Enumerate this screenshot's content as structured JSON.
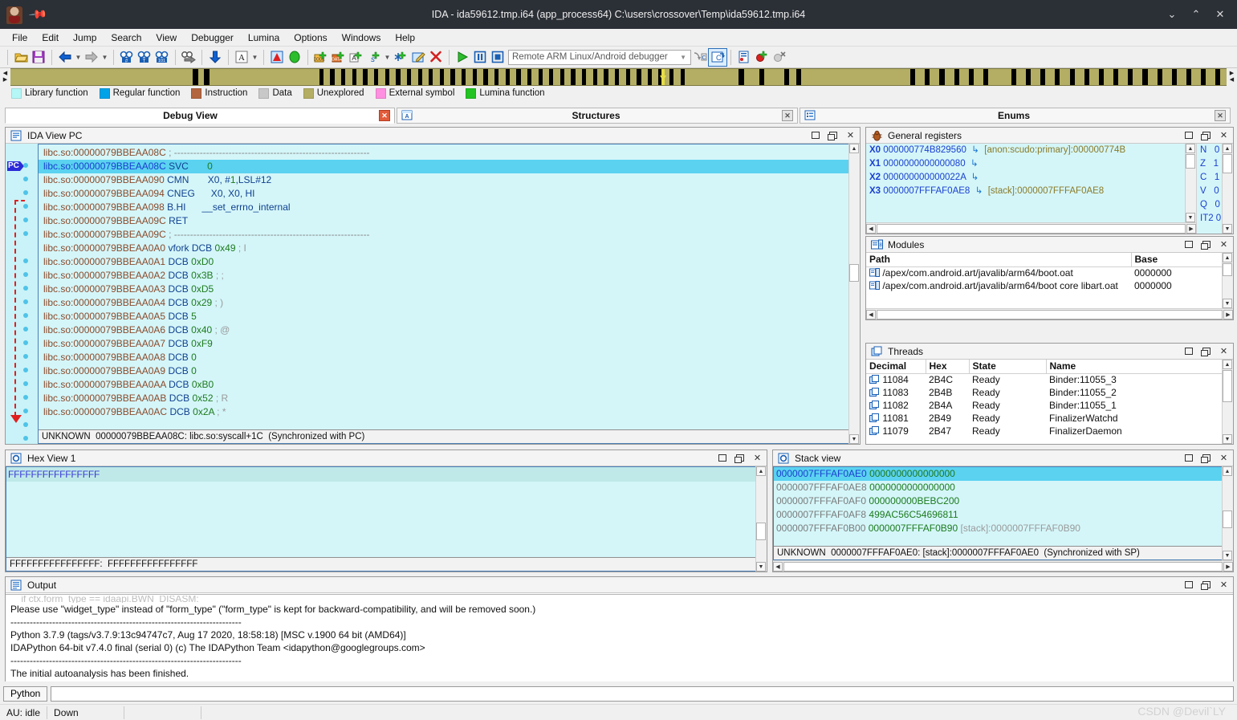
{
  "window": {
    "title": "IDA - ida59612.tmp.i64 (app_process64) C:\\users\\crossover\\Temp\\ida59612.tmp.i64",
    "minimize": "⌄",
    "maximize": "⌃",
    "close": "✕",
    "pin_icon": "pin-icon"
  },
  "menu": [
    {
      "label": "File"
    },
    {
      "label": "Edit"
    },
    {
      "label": "Jump"
    },
    {
      "label": "Search"
    },
    {
      "label": "View"
    },
    {
      "label": "Debugger"
    },
    {
      "label": "Lumina"
    },
    {
      "label": "Options"
    },
    {
      "label": "Windows"
    },
    {
      "label": "Help"
    }
  ],
  "toolbar": {
    "debugger_select": "Remote ARM Linux/Android debugger",
    "icons": [
      "open-file-icon",
      "save-icon",
      "back-icon",
      "forward-icon",
      "search-hash-icon",
      "search-text-icon",
      "search-binary-icon",
      "jump-xref-icon",
      "jump-down-icon",
      "ascii-icon",
      "alert-icon",
      "green-circle-icon",
      "make-code-icon",
      "make-data-icon",
      "make-ascii-icon",
      "make-struct-icon",
      "make-array-icon",
      "edit-func-icon",
      "delete-icon",
      "run-icon",
      "pause-icon",
      "stop-icon",
      "step-into-icon",
      "step-over-icon",
      "breakpoints-icon",
      "add-breakpoint-icon",
      "delete-breakpoint-icon"
    ]
  },
  "navband": {
    "legend": [
      {
        "label": "Library function",
        "color": "#b5f7f7"
      },
      {
        "label": "Regular function",
        "color": "#00a2e8"
      },
      {
        "label": "Instruction",
        "color": "#b3653f"
      },
      {
        "label": "Data",
        "color": "#c8c8c8"
      },
      {
        "label": "Unexplored",
        "color": "#b3ae64"
      },
      {
        "label": "External symbol",
        "color": "#ff8fe0"
      },
      {
        "label": "Lumina function",
        "color": "#22c322"
      }
    ],
    "cursor_position_pct": 53.5,
    "segments_pct": [
      [
        15.0,
        0.45
      ],
      [
        15.9,
        0.45
      ],
      [
        25.4,
        0.35
      ],
      [
        26.3,
        0.35
      ],
      [
        27.2,
        0.35
      ],
      [
        28.1,
        0.35
      ],
      [
        29.0,
        0.35
      ],
      [
        29.9,
        0.35
      ],
      [
        30.8,
        0.35
      ],
      [
        31.7,
        0.35
      ],
      [
        32.6,
        0.35
      ],
      [
        33.5,
        0.35
      ],
      [
        34.4,
        0.35
      ],
      [
        35.3,
        0.35
      ],
      [
        36.2,
        0.35
      ],
      [
        37.1,
        0.35
      ],
      [
        38.0,
        0.35
      ],
      [
        38.9,
        0.35
      ],
      [
        39.8,
        0.35
      ],
      [
        40.7,
        0.35
      ],
      [
        41.6,
        0.35
      ],
      [
        42.5,
        0.35
      ],
      [
        43.4,
        0.35
      ],
      [
        44.3,
        0.35
      ],
      [
        45.2,
        0.35
      ],
      [
        46.1,
        0.35
      ],
      [
        47.0,
        0.35
      ],
      [
        47.9,
        0.35
      ],
      [
        48.8,
        0.35
      ],
      [
        49.7,
        0.35
      ],
      [
        50.6,
        0.35
      ],
      [
        51.5,
        0.35
      ],
      [
        52.4,
        0.35
      ],
      [
        53.3,
        0.35
      ],
      [
        54.2,
        0.35
      ],
      [
        55.1,
        0.35
      ],
      [
        59.9,
        0.4
      ],
      [
        61.6,
        0.4
      ],
      [
        63.6,
        0.4
      ],
      [
        64.6,
        0.4
      ],
      [
        74.0,
        0.4
      ],
      [
        75.2,
        0.4
      ],
      [
        76.4,
        0.4
      ],
      [
        77.6,
        0.4
      ],
      [
        78.8,
        0.4
      ],
      [
        80.0,
        0.4
      ],
      [
        82.3,
        0.4
      ],
      [
        83.5,
        0.4
      ],
      [
        84.7,
        0.4
      ],
      [
        85.9,
        0.4
      ],
      [
        87.1,
        0.4
      ],
      [
        88.3,
        0.4
      ],
      [
        89.5,
        0.4
      ],
      [
        90.7,
        0.4
      ],
      [
        91.9,
        0.4
      ],
      [
        93.1,
        0.4
      ],
      [
        94.3,
        0.4
      ],
      [
        95.5,
        0.4
      ],
      [
        96.7,
        0.4
      ],
      [
        97.9,
        0.4
      ],
      [
        99.1,
        0.4
      ]
    ]
  },
  "window_tabs": [
    {
      "label": "Debug View",
      "active": true,
      "icon": "debug-view-icon",
      "close": "✕"
    },
    {
      "label": "Structures",
      "active": false,
      "icon": "structures-icon",
      "close": "✕"
    },
    {
      "label": "Enums",
      "active": false,
      "icon": "enums-icon",
      "close": "✕"
    }
  ],
  "ida_view": {
    "title": "IDA View PC",
    "icon": "ida-view-icon",
    "buttons": {
      "restore": "restore-icon",
      "tile": "tile-icon",
      "close": "✕"
    },
    "status": "UNKNOWN  00000079BBEAA08C: libc.so:syscall+1C  (Synchronized with PC)",
    "lines": [
      {
        "seg": "libc.so:00000079BBEAA08C",
        "mnem": "",
        "ops": "",
        "comment": "; -------------------------------------------------------------",
        "sel": false,
        "type": "sep"
      },
      {
        "seg": "libc.so:00000079BBEAA08C",
        "mnem": "SVC",
        "ops": "0",
        "comment": "",
        "sel": true,
        "type": "ins"
      },
      {
        "seg": "libc.so:00000079BBEAA090",
        "mnem": "CMN",
        "ops": "X0, #1,LSL#12",
        "comment": "",
        "sel": false,
        "type": "ins"
      },
      {
        "seg": "libc.so:00000079BBEAA094",
        "mnem": "CNEG",
        "ops": "X0, X0, HI",
        "comment": "",
        "sel": false,
        "type": "ins"
      },
      {
        "seg": "libc.so:00000079BBEAA098",
        "mnem": "B.HI",
        "ops": "__set_errno_internal",
        "comment": "",
        "sel": false,
        "type": "ins"
      },
      {
        "seg": "libc.so:00000079BBEAA09C",
        "mnem": "RET",
        "ops": "",
        "comment": "",
        "sel": false,
        "type": "ins"
      },
      {
        "seg": "libc.so:00000079BBEAA09C",
        "mnem": "",
        "ops": "",
        "comment": "; -------------------------------------------------------------",
        "sel": false,
        "type": "sep"
      },
      {
        "seg": "libc.so:00000079BBEAA0A0",
        "label": "vfork",
        "mnem": "DCB",
        "ops": "0x49",
        "comment": "; I",
        "sel": false,
        "type": "dcb"
      },
      {
        "seg": "libc.so:00000079BBEAA0A1",
        "mnem": "DCB",
        "ops": "0xD0",
        "comment": "",
        "sel": false,
        "type": "dcb"
      },
      {
        "seg": "libc.so:00000079BBEAA0A2",
        "mnem": "DCB",
        "ops": "0x3B",
        "comment": "; ;",
        "sel": false,
        "type": "dcb"
      },
      {
        "seg": "libc.so:00000079BBEAA0A3",
        "mnem": "DCB",
        "ops": "0xD5",
        "comment": "",
        "sel": false,
        "type": "dcb"
      },
      {
        "seg": "libc.so:00000079BBEAA0A4",
        "mnem": "DCB",
        "ops": "0x29",
        "comment": "; )",
        "sel": false,
        "type": "dcb"
      },
      {
        "seg": "libc.so:00000079BBEAA0A5",
        "mnem": "DCB",
        "ops": "5",
        "comment": "",
        "sel": false,
        "type": "dcb"
      },
      {
        "seg": "libc.so:00000079BBEAA0A6",
        "mnem": "DCB",
        "ops": "0x40",
        "comment": "; @",
        "sel": false,
        "type": "dcb"
      },
      {
        "seg": "libc.so:00000079BBEAA0A7",
        "mnem": "DCB",
        "ops": "0xF9",
        "comment": "",
        "sel": false,
        "type": "dcb"
      },
      {
        "seg": "libc.so:00000079BBEAA0A8",
        "mnem": "DCB",
        "ops": "0",
        "comment": "",
        "sel": false,
        "type": "dcb"
      },
      {
        "seg": "libc.so:00000079BBEAA0A9",
        "mnem": "DCB",
        "ops": "0",
        "comment": "",
        "sel": false,
        "type": "dcb"
      },
      {
        "seg": "libc.so:00000079BBEAA0AA",
        "mnem": "DCB",
        "ops": "0xB0",
        "comment": "",
        "sel": false,
        "type": "dcb"
      },
      {
        "seg": "libc.so:00000079BBEAA0AB",
        "mnem": "DCB",
        "ops": "0x52",
        "comment": "; R",
        "sel": false,
        "type": "dcb"
      },
      {
        "seg": "libc.so:00000079BBEAA0AC",
        "mnem": "DCB",
        "ops": "0x2A",
        "comment": "; *",
        "sel": false,
        "type": "dcb"
      }
    ]
  },
  "registers": {
    "title": "General registers",
    "icon": "bug-icon",
    "rows": [
      {
        "name": "X0",
        "value": "000000774B829560",
        "arrow": "↳",
        "target": "[anon:scudo:primary]:000000774B"
      },
      {
        "name": "X1",
        "value": "0000000000000080",
        "arrow": "↳",
        "target": ""
      },
      {
        "name": "X2",
        "value": "000000000000022A",
        "arrow": "↳",
        "target": ""
      },
      {
        "name": "X3",
        "value": "0000007FFFAF0AE8",
        "arrow": "↳",
        "target": "[stack]:0000007FFFAF0AE8"
      }
    ],
    "flags": [
      {
        "name": "N",
        "value": "0"
      },
      {
        "name": "Z",
        "value": "1"
      },
      {
        "name": "C",
        "value": "1"
      },
      {
        "name": "V",
        "value": "0"
      },
      {
        "name": "Q",
        "value": "0"
      },
      {
        "name": "IT2",
        "value": "0"
      }
    ]
  },
  "modules": {
    "title": "Modules",
    "icon": "modules-icon",
    "columns": [
      "Path",
      "Base"
    ],
    "rows": [
      {
        "path": "/apex/com.android.art/javalib/arm64/boot.oat",
        "base": "0000000"
      },
      {
        "path": "/apex/com.android.art/javalib/arm64/boot core libart.oat",
        "base": "0000000"
      }
    ]
  },
  "threads": {
    "title": "Threads",
    "icon": "threads-icon",
    "columns": [
      "Decimal",
      "Hex",
      "State",
      "Name"
    ],
    "rows": [
      {
        "decimal": "11084",
        "hex": "2B4C",
        "state": "Ready",
        "name": "Binder:11055_3"
      },
      {
        "decimal": "11083",
        "hex": "2B4B",
        "state": "Ready",
        "name": "Binder:11055_2"
      },
      {
        "decimal": "11082",
        "hex": "2B4A",
        "state": "Ready",
        "name": "Binder:11055_1"
      },
      {
        "decimal": "11081",
        "hex": "2B49",
        "state": "Ready",
        "name": "FinalizerWatchd"
      },
      {
        "decimal": "11079",
        "hex": "2B47",
        "state": "Ready",
        "name": "FinalizerDaemon"
      }
    ]
  },
  "hex_view": {
    "title": "Hex View 1",
    "icon": "hex-view-icon",
    "rows": [
      "FFFFFFFFFFFFFFFF"
    ],
    "status": "FFFFFFFFFFFFFFFF:  FFFFFFFFFFFFFFFF"
  },
  "stack_view": {
    "title": "Stack view",
    "icon": "stack-view-icon",
    "status": "UNKNOWN  0000007FFFAF0AE0: [stack]:0000007FFFAF0AE0  (Synchronized with SP)",
    "rows": [
      {
        "addr": "0000007FFFAF0AE0",
        "value": "0000000000000000",
        "tag": "",
        "sel": true
      },
      {
        "addr": "0000007FFFAF0AE8",
        "value": "0000000000000000",
        "tag": "",
        "sel": false
      },
      {
        "addr": "0000007FFFAF0AF0",
        "value": "000000000BEBC200",
        "tag": "",
        "sel": false
      },
      {
        "addr": "0000007FFFAF0AF8",
        "value": "499AC56C54696811",
        "tag": "",
        "sel": false
      },
      {
        "addr": "0000007FFFAF0B00",
        "value": "0000007FFFAF0B90",
        "tag": "[stack]:0000007FFFAF0B90",
        "sel": false
      }
    ]
  },
  "output": {
    "title": "Output",
    "icon": "output-icon",
    "lines": [
      "    if ctx.form_type == idaapi.BWN_DISASM:",
      "Please use \"widget_type\" instead of \"form_type\" (\"form_type\" is kept for backward-compatibility, and will be removed soon.)",
      "------------------------------------------------------------------------",
      "Python 3.7.9 (tags/v3.7.9:13c94747c7, Aug 17 2020, 18:58:18) [MSC v.1900 64 bit (AMD64)]",
      "IDAPython 64-bit v7.4.0 final (serial 0) (c) The IDAPython Team <idapython@googlegroups.com>",
      "------------------------------------------------------------------------",
      "The initial autoanalysis has been finished."
    ],
    "cli_button": "Python",
    "cli_value": ""
  },
  "statusbar": {
    "au": "AU:  idle",
    "direction": "Down",
    "cell3": "",
    "cell4": ""
  },
  "watermark": "CSDN @Devil`LY"
}
